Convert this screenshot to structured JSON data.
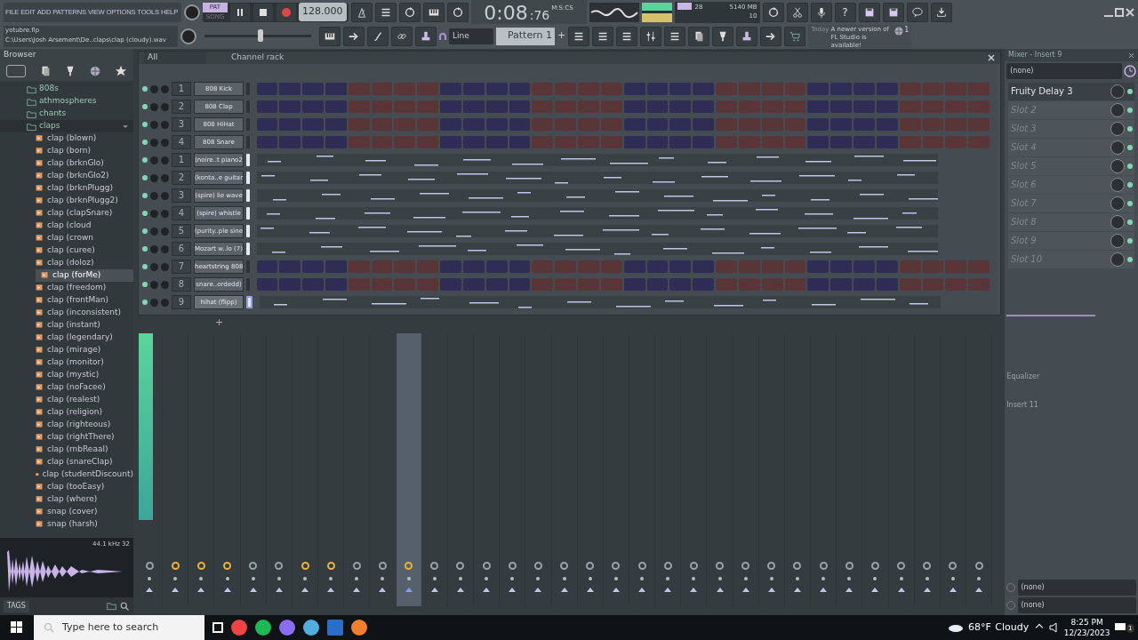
{
  "menu": [
    "FILE",
    "EDIT",
    "ADD",
    "PATTERNS",
    "VIEW",
    "OPTIONS",
    "TOOLS",
    "HELP"
  ],
  "project": {
    "file": "yotubre.flp",
    "path": "C:\\Users\\Josh Arsement\\De..claps\\clap (cloudy).wav"
  },
  "transport": {
    "modes": [
      {
        "label": "PAT",
        "selected": true
      },
      {
        "label": "SONG",
        "selected": false
      }
    ],
    "tempo": "128.000"
  },
  "time": {
    "value": "0:08",
    "centis": ":76",
    "unit": "M:S:CS"
  },
  "monitor": {
    "voices": "28",
    "memory": "5140 MB",
    "polyphony": "10"
  },
  "help_key": "?",
  "snap": "Line",
  "pattern": "Pattern 1",
  "pattern_add": "+",
  "news": {
    "label": "Today",
    "message": "A newer version of FL Studio is available!",
    "count": "1"
  },
  "browser": {
    "title": "Browser",
    "tree": [
      {
        "label": "808s",
        "kind": "folder",
        "expanded": false
      },
      {
        "label": "athmospheres",
        "kind": "folder",
        "expanded": false
      },
      {
        "label": "chants",
        "kind": "folder",
        "expanded": false
      },
      {
        "label": "claps",
        "kind": "folder",
        "expanded": true,
        "children": [
          {
            "label": "clap (blown)",
            "kind": "file",
            "selected": false
          },
          {
            "label": "clap (born)",
            "kind": "file",
            "selected": false
          },
          {
            "label": "clap (brknGlo)",
            "kind": "file",
            "selected": false
          },
          {
            "label": "clap (brknGlo2)",
            "kind": "file",
            "selected": false
          },
          {
            "label": "clap (brknPlugg)",
            "kind": "file",
            "selected": false
          },
          {
            "label": "clap (brknPlugg2)",
            "kind": "file",
            "selected": false
          },
          {
            "label": "clap (clapSnare)",
            "kind": "file",
            "selected": false
          },
          {
            "label": "clap (cloud",
            "kind": "file",
            "selected": false
          },
          {
            "label": "clap (crown",
            "kind": "file",
            "selected": false
          },
          {
            "label": "clap (curee)",
            "kind": "file",
            "selected": false
          },
          {
            "label": "clap (doloz)",
            "kind": "file",
            "selected": false
          },
          {
            "label": "clap (forMe)",
            "kind": "file",
            "selected": true
          },
          {
            "label": "clap (freedom)",
            "kind": "file",
            "selected": false
          },
          {
            "label": "clap (frontMan)",
            "kind": "file",
            "selected": false
          },
          {
            "label": "clap (inconsistent)",
            "kind": "file",
            "selected": false
          },
          {
            "label": "clap (instant)",
            "kind": "file",
            "selected": false
          },
          {
            "label": "clap (legendary)",
            "kind": "file",
            "selected": false
          },
          {
            "label": "clap (mirage)",
            "kind": "file",
            "selected": false
          },
          {
            "label": "clap (monitor)",
            "kind": "file",
            "selected": false
          },
          {
            "label": "clap (mystic)",
            "kind": "file",
            "selected": false
          },
          {
            "label": "clap (noFacee)",
            "kind": "file",
            "selected": false
          },
          {
            "label": "clap (realest)",
            "kind": "file",
            "selected": false
          },
          {
            "label": "clap (religion)",
            "kind": "file",
            "selected": false
          },
          {
            "label": "clap (righteous)",
            "kind": "file",
            "selected": false
          },
          {
            "label": "clap (rightThere)",
            "kind": "file",
            "selected": false
          },
          {
            "label": "clap (rnbReaal)",
            "kind": "file",
            "selected": false
          },
          {
            "label": "clap (snareClap)",
            "kind": "file",
            "selected": false
          },
          {
            "label": "clap (studentDiscount)",
            "kind": "file",
            "selected": false
          },
          {
            "label": "clap (tooEasy)",
            "kind": "file",
            "selected": false
          },
          {
            "label": "clap (where)",
            "kind": "file",
            "selected": false
          },
          {
            "label": "snap (cover)",
            "kind": "file",
            "selected": false
          },
          {
            "label": "snap (harsh)",
            "kind": "file",
            "selected": false
          }
        ]
      }
    ],
    "sample_info": "44.1 kHz 32",
    "tags": "TAGS"
  },
  "channel_rack": {
    "title": "Channel rack",
    "filter": "All",
    "add": "+",
    "channels": [
      {
        "number": "1",
        "name": "808 Kick",
        "kind": "steps",
        "selected": false
      },
      {
        "number": "2",
        "name": "808 Clap",
        "kind": "steps",
        "selected": false
      },
      {
        "number": "3",
        "name": "808 HiHat",
        "kind": "steps",
        "selected": false
      },
      {
        "number": "4",
        "name": "808 Snare",
        "kind": "steps",
        "selected": false
      },
      {
        "number": "1",
        "name": "(noire..t piano2",
        "kind": "roll",
        "selected": false
      },
      {
        "number": "2",
        "name": "(konta..e guitar",
        "kind": "roll",
        "selected": false
      },
      {
        "number": "3",
        "name": "(spire) lie wave",
        "kind": "roll",
        "selected": false
      },
      {
        "number": "4",
        "name": "(spire) whistle",
        "kind": "roll",
        "selected": false
      },
      {
        "number": "5",
        "name": "(purity..ple sine",
        "kind": "roll",
        "selected": false
      },
      {
        "number": "6",
        "name": "Mozart w..lo (7)",
        "kind": "roll",
        "selected": false
      },
      {
        "number": "7",
        "name": "heartstring 808",
        "kind": "steps",
        "selected": false
      },
      {
        "number": "8",
        "name": "snare..ordedd)",
        "kind": "steps",
        "selected": false
      },
      {
        "number": "9",
        "name": "hihat (flipp)",
        "kind": "roll",
        "selected": true
      }
    ]
  },
  "mixer": {
    "title": "Mixer - Insert 9",
    "insert_label": "Insert 11",
    "input": "(none)",
    "slots": [
      {
        "label": "Fruity Delay 3",
        "empty": false
      },
      {
        "label": "Slot 2",
        "empty": true
      },
      {
        "label": "Slot 3",
        "empty": true
      },
      {
        "label": "Slot 4",
        "empty": true
      },
      {
        "label": "Slot 5",
        "empty": true
      },
      {
        "label": "Slot 6",
        "empty": true
      },
      {
        "label": "Slot 7",
        "empty": true
      },
      {
        "label": "Slot 8",
        "empty": true
      },
      {
        "label": "Slot 9",
        "empty": true
      },
      {
        "label": "Slot 10",
        "empty": true
      }
    ],
    "eq_label": "Equalizer",
    "outputs": [
      "(none)",
      "(none)"
    ],
    "tracks": [
      {
        "routed": false,
        "selected": false
      },
      {
        "routed": true,
        "selected": false
      },
      {
        "routed": true,
        "selected": false
      },
      {
        "routed": true,
        "selected": false
      },
      {
        "routed": false,
        "selected": false
      },
      {
        "routed": false,
        "selected": false
      },
      {
        "routed": true,
        "selected": false
      },
      {
        "routed": true,
        "selected": false
      },
      {
        "routed": false,
        "selected": false
      },
      {
        "routed": false,
        "selected": false
      },
      {
        "routed": true,
        "selected": true
      },
      {
        "routed": false,
        "selected": false
      },
      {
        "routed": false,
        "selected": false
      },
      {
        "routed": false,
        "selected": false
      },
      {
        "routed": false,
        "selected": false
      },
      {
        "routed": false,
        "selected": false
      },
      {
        "routed": false,
        "selected": false
      },
      {
        "routed": false,
        "selected": false
      },
      {
        "routed": false,
        "selected": false
      },
      {
        "routed": false,
        "selected": false
      },
      {
        "routed": false,
        "selected": false
      },
      {
        "routed": false,
        "selected": false
      },
      {
        "routed": false,
        "selected": false
      },
      {
        "routed": false,
        "selected": false
      },
      {
        "routed": false,
        "selected": false
      },
      {
        "routed": false,
        "selected": false
      },
      {
        "routed": false,
        "selected": false
      },
      {
        "routed": false,
        "selected": false
      },
      {
        "routed": false,
        "selected": false
      },
      {
        "routed": false,
        "selected": false
      },
      {
        "routed": false,
        "selected": false
      },
      {
        "routed": false,
        "selected": false
      },
      {
        "routed": false,
        "selected": false
      }
    ]
  },
  "taskbar": {
    "search_placeholder": "Type here to search",
    "temperature": "68°F",
    "weather": "Cloudy",
    "clock": "8:25 PM",
    "date": "12/23/2023",
    "notifications": "1"
  }
}
